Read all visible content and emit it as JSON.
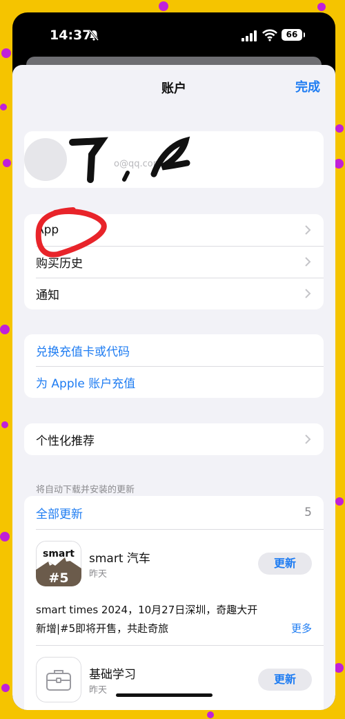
{
  "status_bar": {
    "time": "14:37",
    "battery": "66"
  },
  "nav": {
    "title": "账户",
    "done": "完成"
  },
  "profile": {
    "email_fragment": "o@qq.com"
  },
  "menu": [
    {
      "label": "App"
    },
    {
      "label": "购买历史"
    },
    {
      "label": "通知"
    }
  ],
  "payment": [
    {
      "label": "兑换充值卡或代码"
    },
    {
      "label": "为 Apple 账户充值"
    }
  ],
  "personalized": {
    "label": "个性化推荐"
  },
  "updates": {
    "section_header": "将自动下载并安装的更新",
    "update_all": "全部更新",
    "count": "5",
    "apps": [
      {
        "name": "smart 汽车",
        "date": "昨天",
        "button": "更新",
        "icon_text": "smart",
        "icon_badge": "#5",
        "notes_line1": "smart times 2024，10月27日深圳，奇趣大开",
        "notes_line2": "新增|#5即将开售，共赴奇旅",
        "more": "更多"
      },
      {
        "name": "基础学习",
        "date": "昨天",
        "button": "更新"
      }
    ]
  },
  "colors": {
    "accent": "#1e7cf2",
    "background": "#f5c400",
    "dots": "#c020d8",
    "annotation": "#e8242a"
  }
}
